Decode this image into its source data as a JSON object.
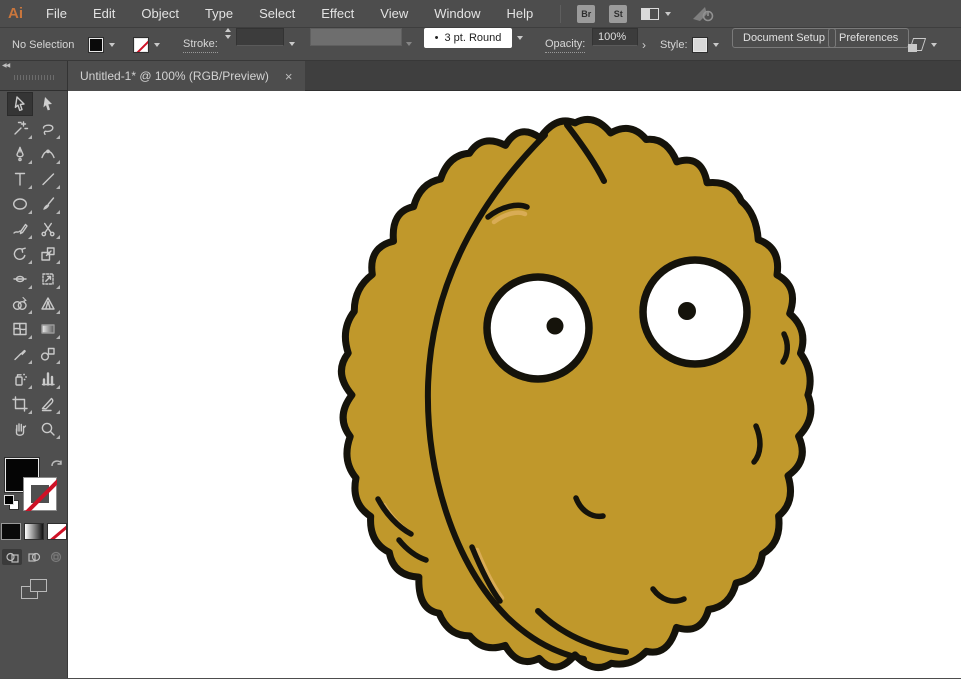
{
  "app": {
    "logo": "Ai"
  },
  "menu": {
    "items": [
      "File",
      "Edit",
      "Object",
      "Type",
      "Select",
      "Effect",
      "View",
      "Window",
      "Help"
    ],
    "bridge_button": "Br",
    "stock_button": "St",
    "right_icons": [
      "arrange-documents-icon",
      "chevron-down-icon",
      "gpu-performance-icon"
    ]
  },
  "control_bar": {
    "selection_status": "No Selection",
    "fill_swatch": "black",
    "stroke_swatch": "none",
    "stroke_label": "Stroke:",
    "brush_dot": "•",
    "brush_value": "3 pt. Round",
    "opacity_label": "Opacity:",
    "opacity_value": "100%",
    "opacity_expand": "›",
    "style_label": "Style:",
    "document_setup_button": "Document Setup",
    "preferences_button": "Preferences"
  },
  "tab": {
    "title": "Untitled-1* @ 100% (RGB/Preview)",
    "close": "×"
  },
  "toolbar": {
    "tools": [
      "selection-tool",
      "direct-selection-tool",
      "magic-wand-tool",
      "lasso-tool",
      "pen-tool",
      "curvature-tool",
      "type-tool",
      "line-segment-tool",
      "ellipse-tool",
      "paintbrush-tool",
      "shaper-tool",
      "scissors-tool",
      "rotate-tool",
      "scale-tool",
      "width-tool",
      "free-transform-tool",
      "shape-builder-tool",
      "perspective-grid-tool",
      "mesh-tool",
      "gradient-tool",
      "eyedropper-tool",
      "blend-tool",
      "symbol-sprayer-tool",
      "column-graph-tool",
      "artboard-tool",
      "slice-tool",
      "hand-tool",
      "zoom-tool"
    ],
    "bottom_widgets": [
      "fill-color",
      "stroke-color",
      "swap-fill-stroke",
      "default-fill-stroke",
      "color-mode",
      "gradient-mode",
      "none-mode",
      "draw-normal",
      "draw-behind",
      "draw-inside",
      "screen-mode"
    ]
  },
  "artwork": {
    "subject": "wall-nut cartoon character",
    "colors": {
      "body": "#C0982B",
      "outline": "#15130B",
      "highlight": "#D9AC55",
      "eye_white": "#FFFFFF"
    }
  },
  "ui_colors": {
    "bar_background": "#4D4D4D",
    "well_background": "#3C3C3C",
    "canvas_background": "#FFFFFF",
    "logo_orange": "#C9763D",
    "none_red": "#CE1126"
  }
}
